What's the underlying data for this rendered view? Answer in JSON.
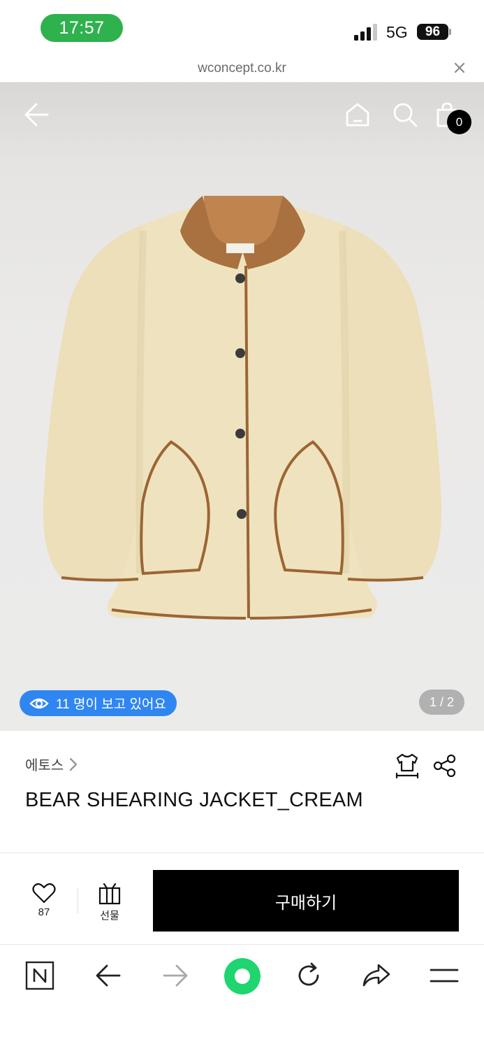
{
  "status_bar": {
    "time": "17:57",
    "network": "5G",
    "battery": "96"
  },
  "url_bar": {
    "url": "wconcept.co.kr"
  },
  "hero": {
    "cart_count": "0",
    "viewers_text": "11 명이 보고 있어요",
    "page_indicator": "1 / 2"
  },
  "product": {
    "brand": "에토스",
    "title": "BEAR SHEARING JACKET_CREAM"
  },
  "action_bar": {
    "like_count": "87",
    "gift_label": "선물",
    "buy_label": "구매하기"
  },
  "icons": [
    "back-arrow-icon",
    "home-icon",
    "search-icon",
    "cart-icon",
    "eye-icon",
    "chevron-right-icon",
    "size-guide-icon",
    "share-icon",
    "heart-icon",
    "gift-icon",
    "naver-icon",
    "reload-icon",
    "forward-share-icon",
    "menu-icon"
  ],
  "colors": {
    "time_pill": "#2fb14e",
    "viewers_pill": "#2f86f0",
    "buy_button": "#000000",
    "green_dot": "#1ed56f"
  }
}
